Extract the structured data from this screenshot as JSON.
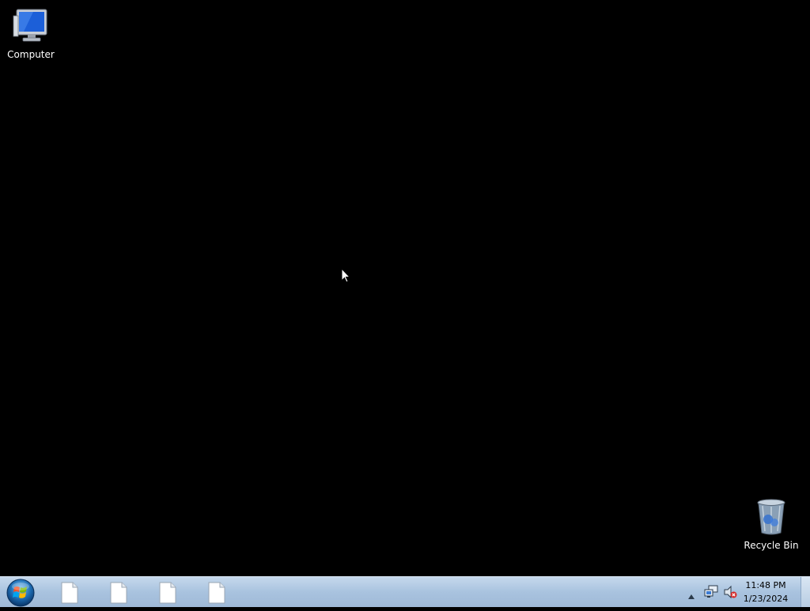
{
  "desktop": {
    "background_color": "#000000",
    "icons": [
      {
        "label": "Computer",
        "icon": "computer-icon"
      },
      {
        "label": "Recycle Bin",
        "icon": "recycle-bin-icon"
      }
    ]
  },
  "taskbar": {
    "color": "#a9c3df",
    "start_icon": "windows-start-orb",
    "buttons": [
      {
        "icon": "blank-document-icon"
      },
      {
        "icon": "blank-document-icon"
      },
      {
        "icon": "blank-document-icon"
      },
      {
        "icon": "blank-document-icon"
      }
    ],
    "tray": {
      "icons": [
        "show-hidden-icons-arrow",
        "network-icon",
        "volume-muted-icon"
      ],
      "time": "11:48 PM",
      "date": "1/23/2024"
    }
  }
}
